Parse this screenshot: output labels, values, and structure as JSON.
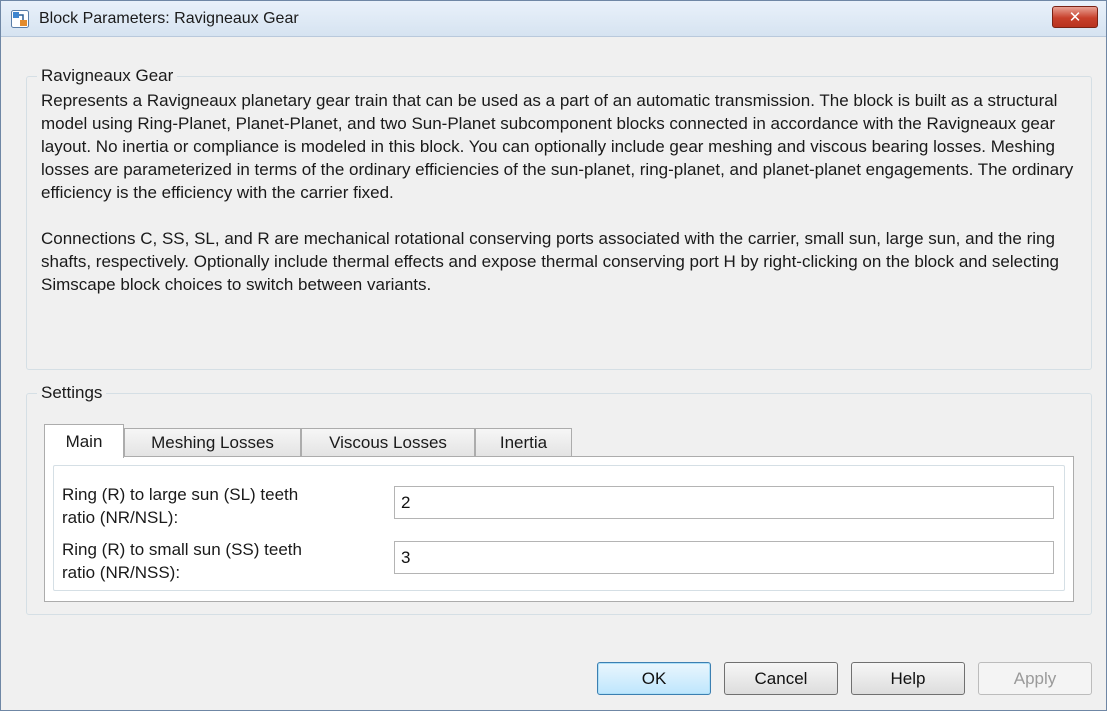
{
  "window": {
    "title": "Block Parameters: Ravigneaux Gear",
    "close_glyph": "✕"
  },
  "description": {
    "legend": "Ravigneaux Gear",
    "paragraph1": "Represents a Ravigneaux planetary gear train that can be used as a part of an automatic transmission. The block is built as a structural model using Ring-Planet, Planet-Planet, and two Sun-Planet subcomponent blocks connected in accordance with the Ravigneaux gear layout. No inertia or compliance is modeled in this block. You can optionally include gear meshing and viscous bearing losses. Meshing losses are parameterized in terms of the ordinary efficiencies of the sun-planet, ring-planet, and planet-planet engagements. The ordinary efficiency is the efficiency with the carrier fixed.",
    "paragraph2": "Connections C, SS, SL, and R are mechanical rotational conserving ports associated with the carrier, small sun, large sun, and the ring shafts, respectively. Optionally include thermal effects and expose thermal conserving port H by right-clicking on the block and selecting Simscape block choices to switch between variants."
  },
  "settings": {
    "legend": "Settings",
    "tabs": [
      {
        "label": "Main",
        "active": true
      },
      {
        "label": "Meshing Losses",
        "active": false
      },
      {
        "label": "Viscous Losses",
        "active": false
      },
      {
        "label": "Inertia",
        "active": false
      }
    ],
    "params": [
      {
        "label_line1": "Ring (R) to large sun (SL) teeth",
        "label_line2": "ratio (NR/NSL):",
        "value": "2"
      },
      {
        "label_line1": "Ring (R) to small sun (SS) teeth",
        "label_line2": "ratio (NR/NSS):",
        "value": "3"
      }
    ]
  },
  "buttons": {
    "ok": "OK",
    "cancel": "Cancel",
    "help": "Help",
    "apply": "Apply"
  },
  "colors": {
    "accent": "#3c7fb1",
    "close_button": "#c7402b",
    "window_bg": "#f0f0f0"
  }
}
